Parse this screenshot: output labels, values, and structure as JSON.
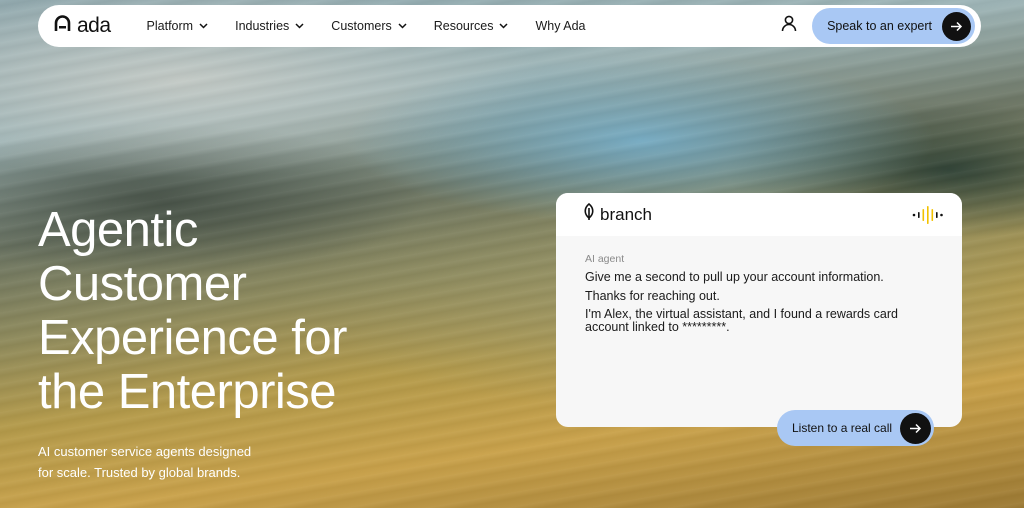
{
  "nav": {
    "logo_text": "ada",
    "links": [
      {
        "label": "Platform",
        "has_dropdown": true
      },
      {
        "label": "Industries",
        "has_dropdown": true
      },
      {
        "label": "Customers",
        "has_dropdown": true
      },
      {
        "label": "Resources",
        "has_dropdown": true
      },
      {
        "label": "Why Ada",
        "has_dropdown": false
      }
    ],
    "cta_label": "Speak to an expert",
    "icons": {
      "user": "user-icon",
      "arrow": "arrow-right-icon",
      "chevron": "chevron-down-icon"
    }
  },
  "hero": {
    "title_lines": [
      "Agentic",
      "Customer",
      "Experience for",
      "the Enterprise"
    ],
    "subtitle_lines": [
      "AI customer service agents designed",
      "for scale. Trusted by global brands."
    ]
  },
  "chat_card": {
    "brand_text": "branch",
    "agent_label": "AI agent",
    "messages": [
      "Give me a second to pull up your account information.",
      "Thanks for reaching out.",
      "I'm Alex, the virtual assistant, and I found a rewards card account linked to *********."
    ],
    "listen_label": "Listen to a real call",
    "icons": {
      "brand": "leaf-icon",
      "wave": "audio-wave-icon",
      "arrow": "arrow-right-icon"
    }
  },
  "colors": {
    "accent_button": "#a9c8f4",
    "button_dark": "#111111",
    "wave_accent": "#f2c200"
  }
}
